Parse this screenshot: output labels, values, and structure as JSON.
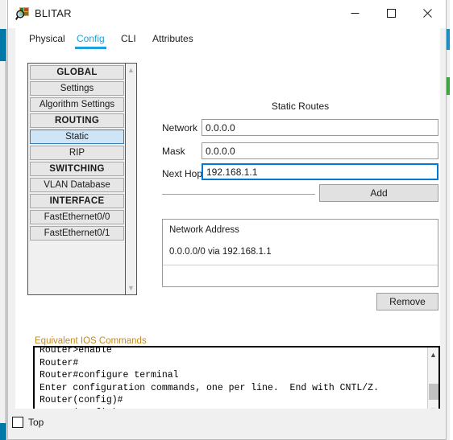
{
  "window": {
    "title": "BLITAR",
    "icon": "packet-tracer-icon",
    "minimize_label": "—",
    "maximize_label": "☐",
    "close_label": "✕"
  },
  "tabs": [
    {
      "label": "Physical",
      "active": false
    },
    {
      "label": "Config",
      "active": true
    },
    {
      "label": "CLI",
      "active": false
    },
    {
      "label": "Attributes",
      "active": false
    }
  ],
  "sidebar": {
    "items": [
      {
        "label": "GLOBAL",
        "type": "header",
        "selected": false
      },
      {
        "label": "Settings",
        "type": "item",
        "selected": false
      },
      {
        "label": "Algorithm Settings",
        "type": "item",
        "selected": false
      },
      {
        "label": "ROUTING",
        "type": "header",
        "selected": false
      },
      {
        "label": "Static",
        "type": "item",
        "selected": true
      },
      {
        "label": "RIP",
        "type": "item",
        "selected": false
      },
      {
        "label": "SWITCHING",
        "type": "header",
        "selected": false
      },
      {
        "label": "VLAN Database",
        "type": "item",
        "selected": false
      },
      {
        "label": "INTERFACE",
        "type": "header",
        "selected": false
      },
      {
        "label": "FastEthernet0/0",
        "type": "item",
        "selected": false
      },
      {
        "label": "FastEthernet0/1",
        "type": "item",
        "selected": false
      }
    ],
    "scroll_up_icon": "chevron-up-icon",
    "scroll_down_icon": "chevron-down-icon"
  },
  "static_routes": {
    "title": "Static Routes",
    "fields": {
      "network": {
        "label": "Network",
        "value": "0.0.0.0",
        "focused": false
      },
      "mask": {
        "label": "Mask",
        "value": "0.0.0.0",
        "focused": false
      },
      "next_hop": {
        "label": "Next Hop",
        "value": "192.168.1.1",
        "focused": true
      }
    },
    "add_label": "Add",
    "remove_label": "Remove",
    "table": {
      "header": "Network Address",
      "rows": [
        "0.0.0.0/0 via 192.168.1.1"
      ]
    }
  },
  "ios": {
    "label": "Equivalent IOS Commands",
    "text": "Router>enable\nRouter#\nRouter#configure terminal\nEnter configuration commands, one per line.  End with CNTL/Z.\nRouter(config)#\nRouter(config)#",
    "scroll_up_icon": "chevron-up-icon",
    "scroll_down_icon": "chevron-down-icon"
  },
  "bottom": {
    "top_checkbox_label": "Top",
    "top_checkbox_checked": false
  },
  "colors": {
    "accent": "#1ba1e2",
    "focus_border": "#0078d7",
    "selection": "#cfe4f7",
    "group_label": "#c08a28",
    "desktop_strip_blue": "#0078a8",
    "desktop_strip_green": "#3fa53f"
  }
}
